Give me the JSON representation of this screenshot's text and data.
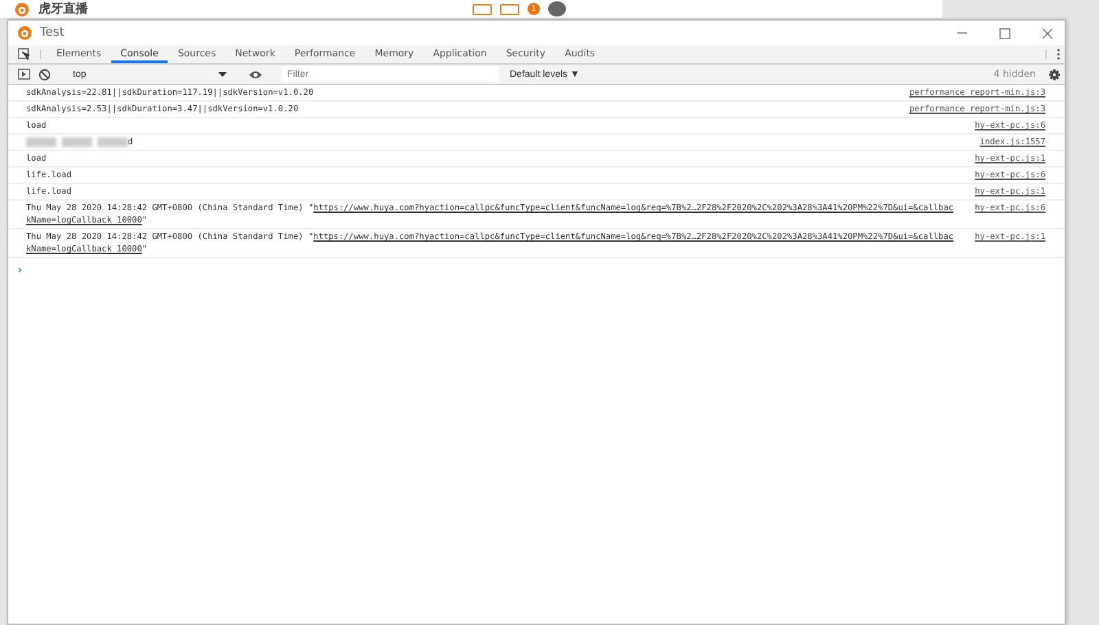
{
  "background_app": {
    "logo_text": "虎牙直播",
    "badge": "1"
  },
  "window": {
    "title": "Test"
  },
  "tabs": [
    {
      "label": "Elements",
      "selected": false
    },
    {
      "label": "Console",
      "selected": true
    },
    {
      "label": "Sources",
      "selected": false
    },
    {
      "label": "Network",
      "selected": false
    },
    {
      "label": "Performance",
      "selected": false
    },
    {
      "label": "Memory",
      "selected": false
    },
    {
      "label": "Application",
      "selected": false
    },
    {
      "label": "Security",
      "selected": false
    },
    {
      "label": "Audits",
      "selected": false
    }
  ],
  "toolbar": {
    "context": "top",
    "filter": {
      "placeholder": "Filter"
    },
    "levels": "Default levels ▼",
    "hidden_count": "4 hidden"
  },
  "messages": [
    {
      "kind": "plain",
      "text": "sdkAnalysis=22.81||sdkDuration=117.19||sdkVersion=v1.0.20",
      "source": "performance_report-min.js:3"
    },
    {
      "kind": "plain",
      "text": "sdkAnalysis=2.53||sdkDuration=3.47||sdkVersion=v1.0.20",
      "source": "performance_report-min.js:3"
    },
    {
      "kind": "plain",
      "text": "load",
      "source": "hy-ext-pc.js:6"
    },
    {
      "kind": "blurred",
      "text": "d",
      "source": "index.js:1557"
    },
    {
      "kind": "plain",
      "text": "load",
      "source": "hy-ext-pc.js:1"
    },
    {
      "kind": "plain",
      "text": "life.load",
      "source": "hy-ext-pc.js:6"
    },
    {
      "kind": "plain",
      "text": "life.load",
      "source": "hy-ext-pc.js:1"
    },
    {
      "kind": "link",
      "lines": [
        {
          "text": "Thu May 28 2020 14:28:42 GMT+0800 (China Standard Time) \"",
          "link": "https://www.huya.com?hyaction=callpc&funcType=client&funcName=log&req=%7B%2…2F28%2F2020%2C%202%3A28%3A41%20PM%22%7D&ui=&callbac"
        },
        {
          "link": "kName=logCallback_10000",
          "text": "\""
        }
      ],
      "source": "hy-ext-pc.js:6"
    },
    {
      "kind": "link",
      "lines": [
        {
          "text": "Thu May 28 2020 14:28:42 GMT+0800 (China Standard Time) \"",
          "link": "https://www.huya.com?hyaction=callpc&funcType=client&funcName=log&req=%7B%2…2F28%2F2020%2C%202%3A28%3A41%20PM%22%7D&ui=&callbac"
        },
        {
          "link": "kName=logCallback_10000",
          "text": "\""
        }
      ],
      "source": "hy-ext-pc.js:1"
    }
  ],
  "prompt": "›"
}
